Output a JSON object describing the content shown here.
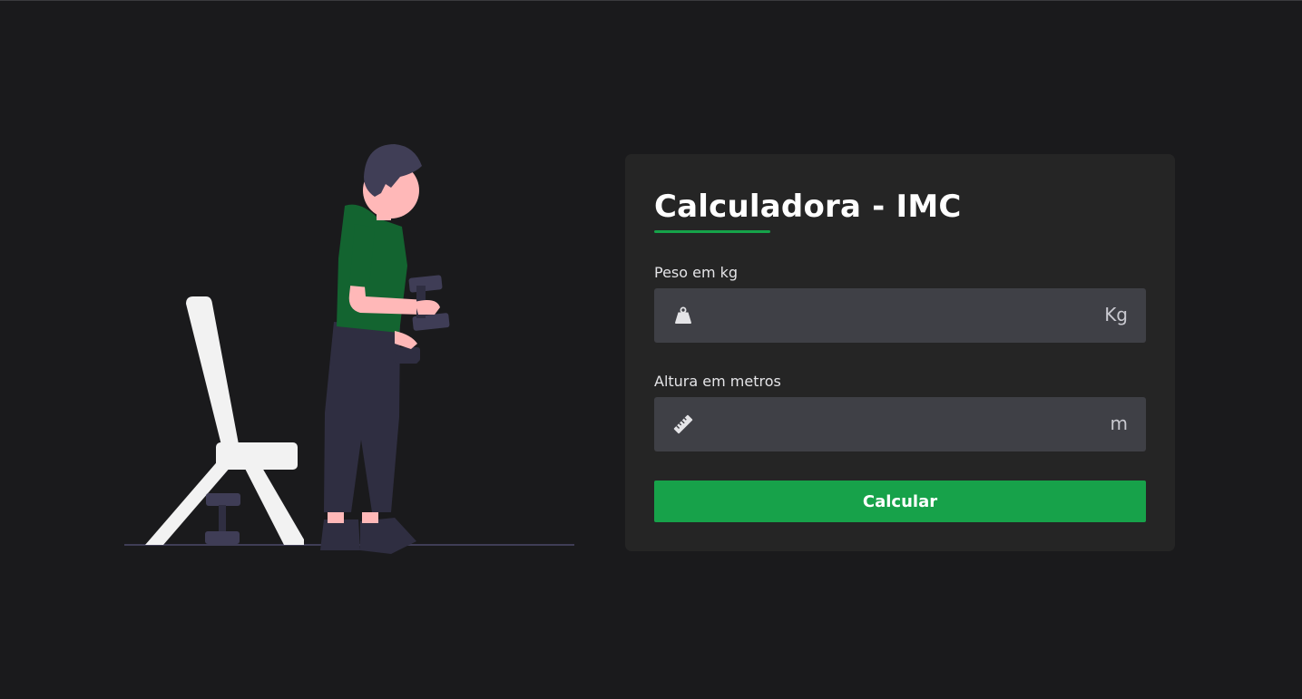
{
  "form": {
    "title": "Calculadora - IMC",
    "weight": {
      "label": "Peso em kg",
      "unit": "Kg",
      "value": "",
      "placeholder": "",
      "icon": "weight-icon"
    },
    "height": {
      "label": "Altura em metros",
      "unit": "m",
      "value": "",
      "placeholder": "",
      "icon": "ruler-icon"
    },
    "submit_label": "Calcular"
  },
  "colors": {
    "background": "#1a1a1c",
    "card": "#252525",
    "input": "#3f4046",
    "accent": "#16a34a",
    "shirt": "#136430",
    "skin": "#ffb8b8",
    "hair": "#403e56",
    "pants": "#2f2e41",
    "bench": "#f2f2f2"
  },
  "illustration": {
    "name": "person-lifting-dumbbells-illustration"
  }
}
